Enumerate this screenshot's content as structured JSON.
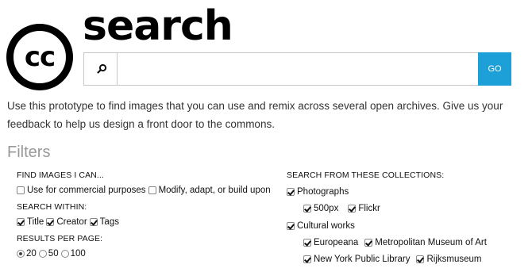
{
  "header": {
    "logo_text": "cc",
    "title": "search"
  },
  "search": {
    "icon": "search-icon",
    "value": "",
    "placeholder": "",
    "go_label": "GO",
    "go_color": "#1da0d7"
  },
  "intro": "Use this prototype to find images that you can use and remix across several open archives. Give us your feedback to help us design a front door to the commons.",
  "filters": {
    "heading": "Filters",
    "find_images": {
      "heading": "FIND IMAGES I CAN...",
      "options": [
        {
          "label": "Use for commercial purposes",
          "checked": false
        },
        {
          "label": "Modify, adapt, or build upon",
          "checked": false
        }
      ]
    },
    "search_within": {
      "heading": "SEARCH WITHIN:",
      "options": [
        {
          "label": "Title",
          "checked": true
        },
        {
          "label": "Creator",
          "checked": true
        },
        {
          "label": "Tags",
          "checked": true
        }
      ]
    },
    "results_per_page": {
      "heading": "RESULTS PER PAGE:",
      "options": [
        {
          "label": "20",
          "selected": true
        },
        {
          "label": "50",
          "selected": false
        },
        {
          "label": "100",
          "selected": false
        }
      ]
    },
    "collections": {
      "heading": "SEARCH FROM THESE COLLECTIONS:",
      "photographs": {
        "label": "Photographs",
        "checked": true,
        "items": [
          {
            "label": "500px",
            "checked": true
          },
          {
            "label": "Flickr",
            "checked": true
          }
        ]
      },
      "cultural_works": {
        "label": "Cultural works",
        "checked": true,
        "items": [
          {
            "label": "Europeana",
            "checked": true
          },
          {
            "label": "Metropolitan Museum of Art",
            "checked": true
          },
          {
            "label": "New York Public Library",
            "checked": true
          },
          {
            "label": "Rijksmuseum",
            "checked": true
          }
        ]
      }
    }
  }
}
